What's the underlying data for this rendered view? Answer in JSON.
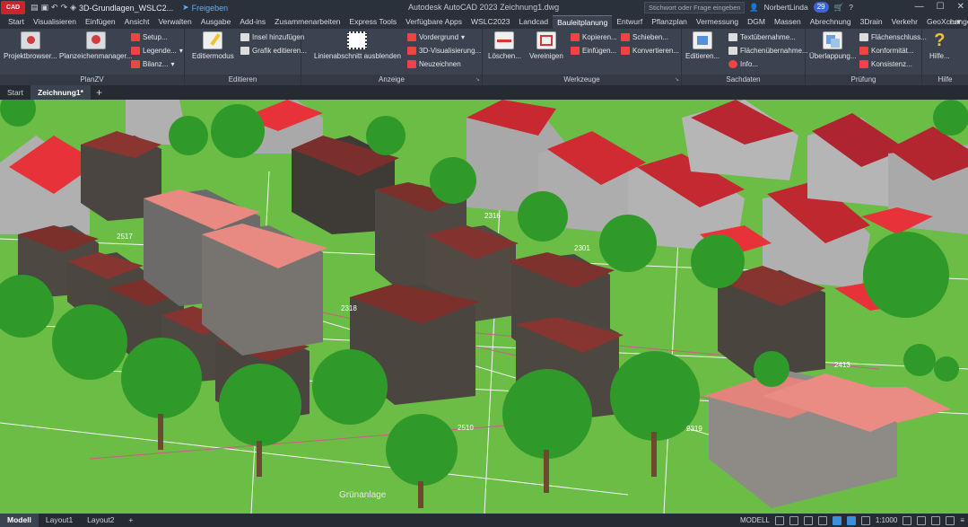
{
  "titlebar": {
    "app_badge": "CAD",
    "project_name": "3D-Grundlagen_WSLC2...",
    "share_label": "Freigeben",
    "window_title": "Autodesk AutoCAD 2023   Zeichnung1.dwg",
    "search_placeholder": "Stichwort oder Frage eingeben",
    "user_name": "NorbertLinda",
    "notification_count": "29"
  },
  "ribbon_tabs": [
    "Start",
    "Visualisieren",
    "Einfügen",
    "Ansicht",
    "Verwalten",
    "Ausgabe",
    "Add-ins",
    "Zusammenarbeiten",
    "Express Tools",
    "Verfügbare Apps",
    "WSLC2023",
    "Landcad",
    "Bauleitplanung",
    "Entwurf",
    "Pflanzplan",
    "Vermessung",
    "DGM",
    "Massen",
    "Abrechnung",
    "3Drain",
    "Verkehr",
    "GeoXchange"
  ],
  "active_tab": "Bauleitplanung",
  "ribbon": {
    "planzv": {
      "title": "PlanZV",
      "projektbrowser": "Projektbrowser...",
      "planzeichenmanager": "Planzeichenmanager...",
      "setup": "Setup...",
      "legende": "Legende...",
      "bilanz": "Bilanz..."
    },
    "editieren": {
      "title": "Editieren",
      "editiermodus": "Editiermodus",
      "insel": "Insel hinzufügen",
      "grafik": "Grafik editieren..."
    },
    "anzeige": {
      "title": "Anzeige",
      "linienabschnitt": "Linienabschnitt ausblenden",
      "vordergrund": "Vordergrund",
      "visualisierung": "3D-Visualisierung...",
      "neuzeichnen": "Neuzeichnen"
    },
    "werkzeuge": {
      "title": "Werkzeuge",
      "loeschen": "Löschen...",
      "vereinigen": "Vereinigen",
      "kopieren": "Kopieren...",
      "einfuegen": "Einfügen...",
      "schieben": "Schieben...",
      "konvertieren": "Konvertieren..."
    },
    "sachdaten": {
      "title": "Sachdaten",
      "editieren": "Editieren...",
      "textuebernahme": "Textübernahme...",
      "flaechenuebernahme": "Flächenübernahme...",
      "info": "Info..."
    },
    "pruefung": {
      "title": "Prüfung",
      "ueberlappung": "Überlappung...",
      "flaechenschluss": "Flächenschluss...",
      "konformitaet": "Konformität...",
      "konsistenz": "Konsistenz..."
    },
    "hilfe": {
      "title": "Hilfe",
      "hilfe": "Hilfe..."
    }
  },
  "doc_tabs": [
    "Start",
    "Zeichnung1*"
  ],
  "viewport": {
    "label_gruenanlage": "Grünanlage",
    "labels": [
      "2510",
      "2301",
      "2319",
      "2413",
      "2318",
      "2517",
      "2316"
    ]
  },
  "status": {
    "layout_tabs": [
      "Modell",
      "Layout1",
      "Layout2"
    ],
    "mode": "MODELL",
    "scale": "1:1000"
  },
  "colors": {
    "grass": "#6bbd45",
    "roof_red": "#e8323a",
    "roof_brown": "#8a3530",
    "tree": "#2f9a2a",
    "accent": "#3c63d9"
  }
}
